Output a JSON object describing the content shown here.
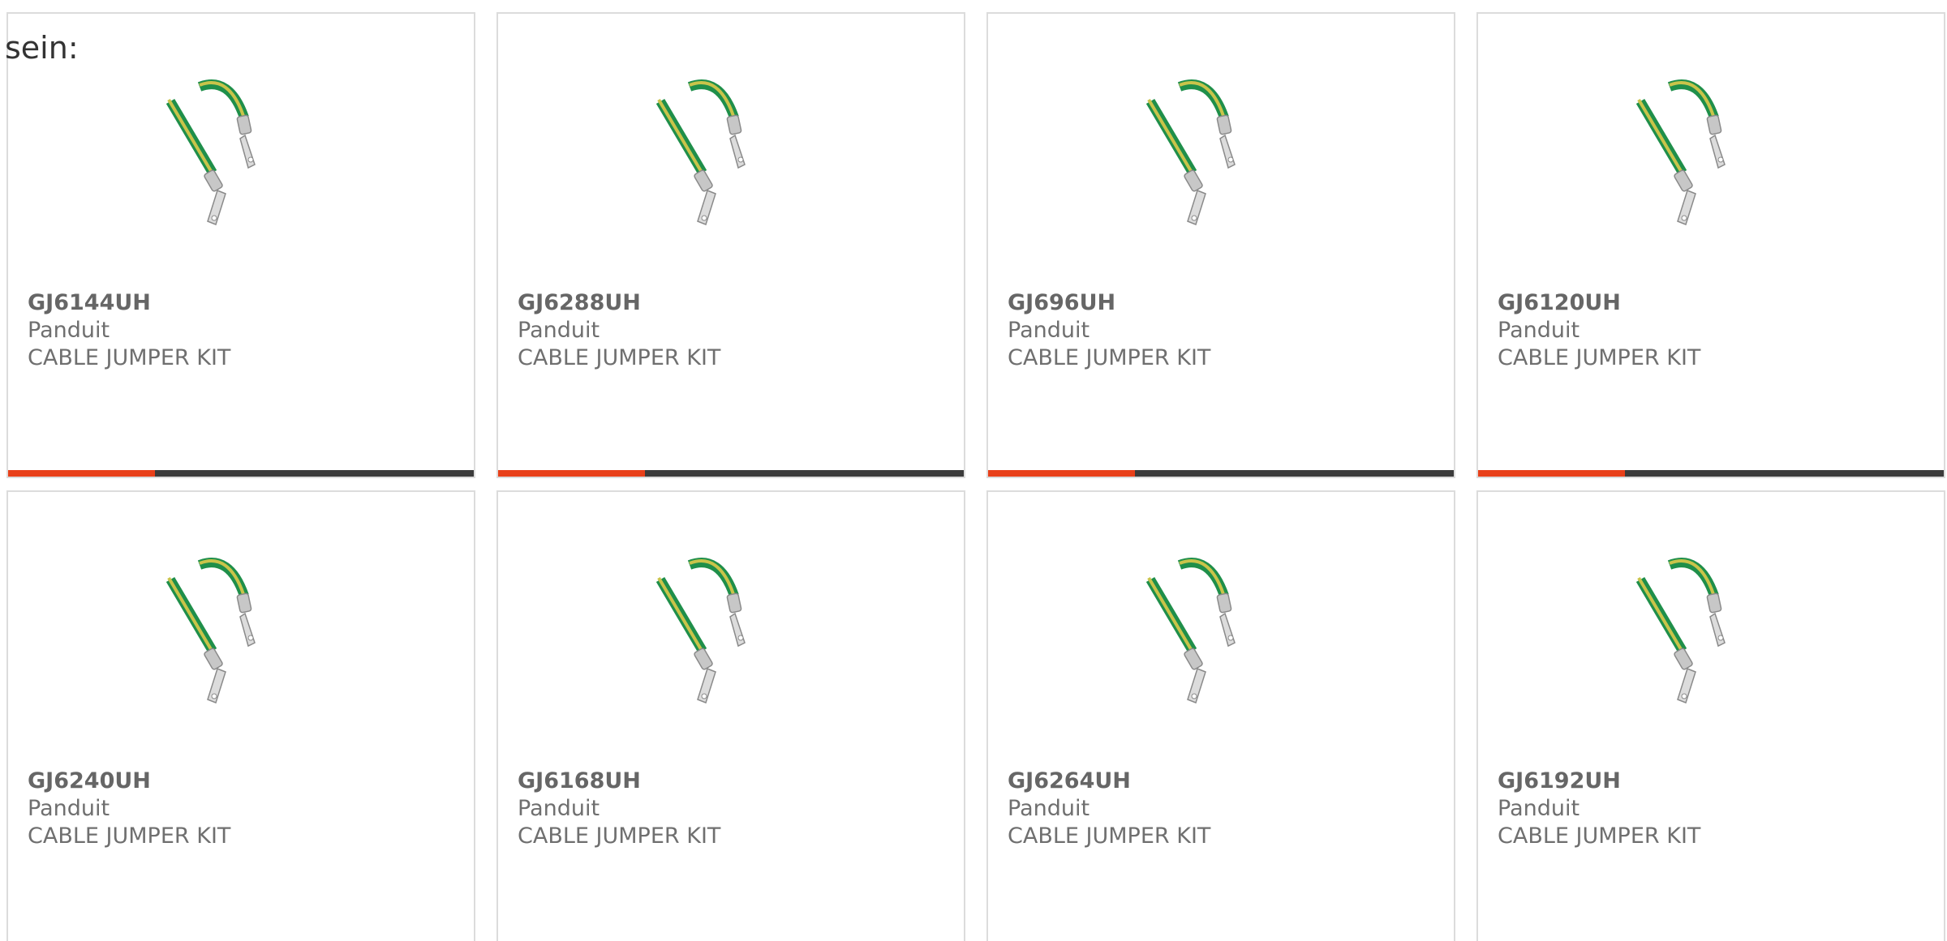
{
  "intro_text": "sein:",
  "colors": {
    "accent": "#e8401a",
    "bar": "#3b3b3b",
    "border": "#dcdcdc",
    "text": "#6f6f6f"
  },
  "products": [
    {
      "sku": "GJ6144UH",
      "brand": "Panduit",
      "description": "CABLE JUMPER KIT",
      "image": "cable-jumper-image",
      "accent_fraction": 0.315
    },
    {
      "sku": "GJ6288UH",
      "brand": "Panduit",
      "description": "CABLE JUMPER KIT",
      "image": "cable-jumper-image",
      "accent_fraction": 0.315
    },
    {
      "sku": "GJ696UH",
      "brand": "Panduit",
      "description": "CABLE JUMPER KIT",
      "image": "cable-jumper-image",
      "accent_fraction": 0.315
    },
    {
      "sku": "GJ6120UH",
      "brand": "Panduit",
      "description": "CABLE JUMPER KIT",
      "image": "cable-jumper-image",
      "accent_fraction": 0.315
    },
    {
      "sku": "GJ6240UH",
      "brand": "Panduit",
      "description": "CABLE JUMPER KIT",
      "image": "cable-jumper-image"
    },
    {
      "sku": "GJ6168UH",
      "brand": "Panduit",
      "description": "CABLE JUMPER KIT",
      "image": "cable-jumper-image"
    },
    {
      "sku": "GJ6264UH",
      "brand": "Panduit",
      "description": "CABLE JUMPER KIT",
      "image": "cable-jumper-image"
    },
    {
      "sku": "GJ6192UH",
      "brand": "Panduit",
      "description": "CABLE JUMPER KIT",
      "image": "cable-jumper-image"
    }
  ]
}
